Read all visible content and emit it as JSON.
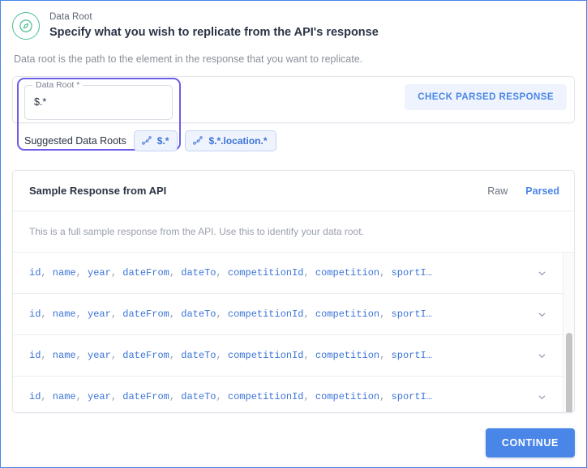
{
  "header": {
    "icon": "compass-icon",
    "eyebrow": "Data Root",
    "title": "Specify what you wish to replicate from the API's response"
  },
  "description": "Data root is the path to the element in the response that you want to replicate.",
  "data_root_field": {
    "label": "Data Root *",
    "value": "$.*",
    "placeholder": "$.*"
  },
  "check_parsed_button": {
    "label": "CHECK PARSED RESPONSE"
  },
  "suggested": {
    "label": "Suggested Data Roots",
    "chips": [
      {
        "icon": "schema-node-icon",
        "label": "$.*"
      },
      {
        "icon": "schema-node-icon",
        "label": "$.*.location.*"
      }
    ]
  },
  "sample_response": {
    "title": "Sample Response from API",
    "toggles": [
      {
        "label": "Raw",
        "active": false
      },
      {
        "label": "Parsed",
        "active": true
      }
    ],
    "note": "This is a full sample response from the API. Use this to identify your data root.",
    "columns": [
      "id",
      "name",
      "year",
      "dateFrom",
      "dateTo",
      "competitionId",
      "competition",
      "sportI…"
    ],
    "rows": [
      {
        "keys": "id, name, year, dateFrom, dateTo, competitionId, competition, sportI…",
        "chevron": "chevron-down-icon"
      },
      {
        "keys": "id, name, year, dateFrom, dateTo, competitionId, competition, sportI…",
        "chevron": "chevron-down-icon"
      },
      {
        "keys": "id, name, year, dateFrom, dateTo, competitionId, competition, sportI…",
        "chevron": "chevron-down-icon"
      },
      {
        "keys": "id, name, year, dateFrom, dateTo, competitionId, competition, sportI…",
        "chevron": "chevron-down-icon"
      }
    ]
  },
  "continue_button": {
    "label": "CONTINUE"
  },
  "colors": {
    "accent_blue": "#4a86e8",
    "chip_blue": "#3b74d6",
    "focus_purple": "#6c5ce7",
    "icon_green": "#4cbf91",
    "muted_text": "#8a8f99",
    "dark_text": "#2b3445"
  }
}
